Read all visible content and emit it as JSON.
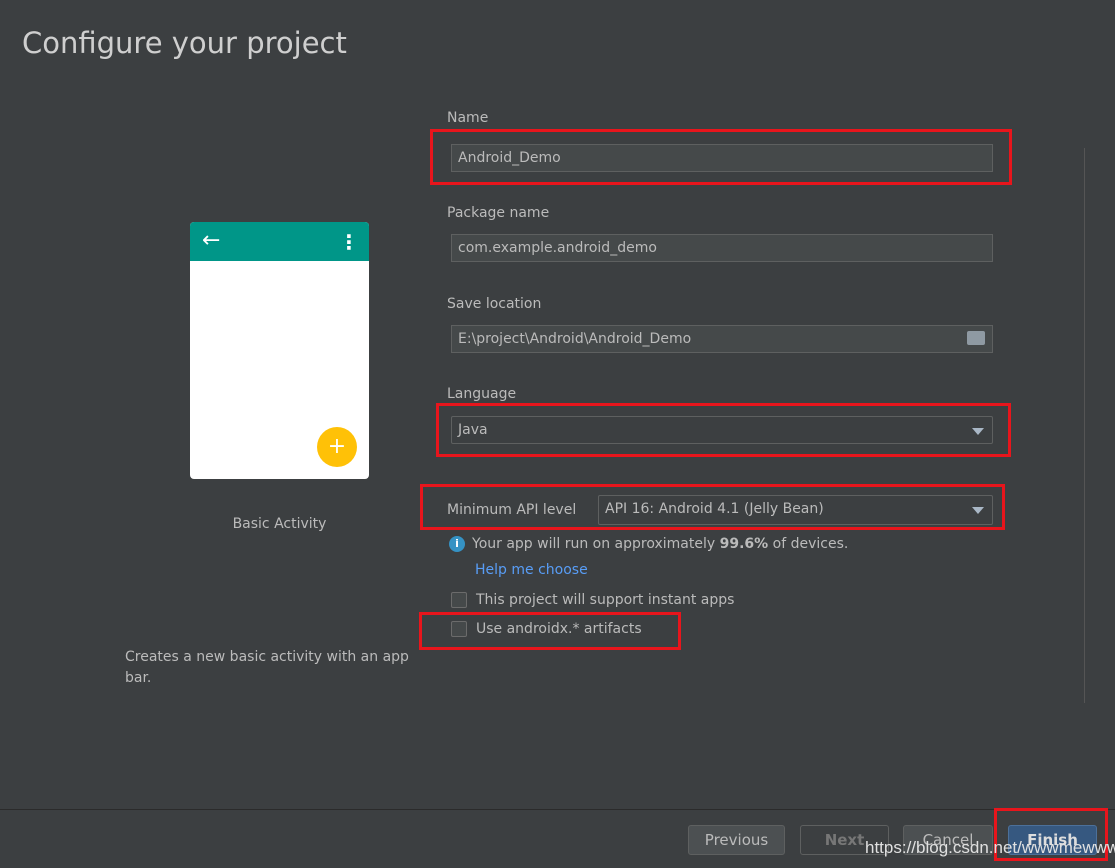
{
  "title": "Configure your project",
  "preview": {
    "template_name": "Basic Activity",
    "description": "Creates a new basic activity with an app bar.",
    "accent": "#009688",
    "fab_color": "#ffc107",
    "fab_glyph": "+"
  },
  "form": {
    "name_label": "Name",
    "name_value": "Android_Demo",
    "package_label": "Package name",
    "package_value": "com.example.android_demo",
    "location_label": "Save location",
    "location_value": "E:\\project\\Android\\Android_Demo",
    "language_label": "Language",
    "language_value": "Java",
    "api_label": "Minimum API level",
    "api_value": "API 16: Android 4.1 (Jelly Bean)",
    "info_prefix": "Your app will run on approximately ",
    "info_percent": "99.6%",
    "info_suffix": " of devices.",
    "help_link": "Help me choose",
    "instant_apps_label": "This project will support instant apps",
    "instant_apps_checked": false,
    "androidx_label": "Use androidx.* artifacts",
    "androidx_checked": false
  },
  "buttons": {
    "previous": "Previous",
    "next": "Next",
    "cancel": "Cancel",
    "finish": "Finish"
  },
  "watermark": "https://blog.csdn.net/wwwmewww",
  "colors": {
    "background": "#3c3f41",
    "finish": "#365880",
    "link": "#589df6",
    "annotation": "#e8151c"
  }
}
